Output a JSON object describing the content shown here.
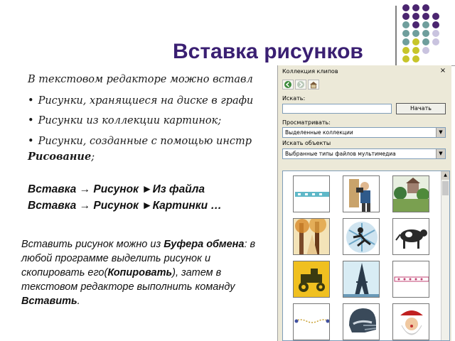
{
  "slide": {
    "title": "Вставка рисунков",
    "intro": "В текстовом редакторе можно вставл",
    "bullets": [
      "Рисунки, хранящиеся на диске в графи",
      "Рисунки из коллекции картинок;",
      "Рисунки, созданные с помощью инстр"
    ],
    "drawing_word": "Рисование",
    "drawing_suffix": ";",
    "commands": [
      {
        "a": "Вставка",
        "arrow": "→",
        "b": "Рисунок",
        "tri": "►",
        "c": "Из файла"
      },
      {
        "a": "Вставка",
        "arrow": "→",
        "b": "Рисунок",
        "tri": "►",
        "c": "Картинки …"
      }
    ],
    "note": {
      "p1": "Вставить рисунок можно из ",
      "b1": "Буфера обмена",
      "p2": ": в любой программе выделить рисунок и скопировать его(",
      "b2": "Копировать",
      "p3": "), затем в текстовом редакторе выполнить команду ",
      "b3": "Вставить",
      "p4": "."
    }
  },
  "pane": {
    "title": "Коллекция клипов",
    "close": "×",
    "toolbar": [
      "back-icon",
      "forward-icon",
      "home-icon"
    ],
    "search_label": "Искать:",
    "search_value": "",
    "search_button": "Начать",
    "browse_label": "Просматривать:",
    "browse_value": "Выделенные коллекции",
    "type_label": "Искать объекты",
    "type_value": "Выбранные типы файлов мультимедиа"
  },
  "colors": {
    "title": "#3a1f72",
    "dot_purple": "#4b2570",
    "dot_teal": "#6f9e9c",
    "dot_yellow": "#c7c52a",
    "dot_lavender": "#c9c3df"
  },
  "clips": [
    "ribbon-clip",
    "photographer-clip",
    "landscape-clip",
    "autumn-trees-clip",
    "snowflake-runner-clip",
    "cow-clip",
    "tractor-clip",
    "eiffel-tower-clip",
    "border-clip",
    "bead-line-clip",
    "football-helmet-clip",
    "santa-clip"
  ]
}
